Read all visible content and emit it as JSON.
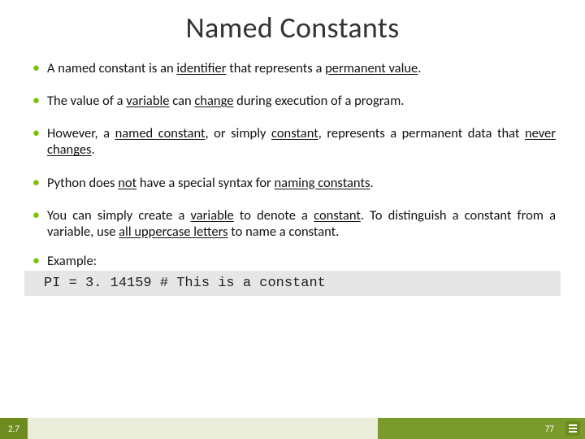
{
  "title": "Named Constants",
  "bullets": [
    {
      "segments": [
        {
          "t": "A named constant is an "
        },
        {
          "t": "identifier",
          "u": true
        },
        {
          "t": " that represents a "
        },
        {
          "t": "permanent value",
          "u": true
        },
        {
          "t": "."
        }
      ]
    },
    {
      "segments": [
        {
          "t": "The value of a "
        },
        {
          "t": "variable",
          "u": true
        },
        {
          "t": " can "
        },
        {
          "t": "change",
          "u": true
        },
        {
          "t": " during execution of a program."
        }
      ]
    },
    {
      "segments": [
        {
          "t": "However, a "
        },
        {
          "t": "named constant",
          "u": true
        },
        {
          "t": ", or simply "
        },
        {
          "t": "constant",
          "u": true
        },
        {
          "t": ", represents a permanent data that "
        },
        {
          "t": "never changes",
          "u": true
        },
        {
          "t": "."
        }
      ]
    },
    {
      "segments": [
        {
          "t": "Python does "
        },
        {
          "t": "not",
          "u": true
        },
        {
          "t": " have a special syntax for "
        },
        {
          "t": "naming constants",
          "u": true
        },
        {
          "t": "."
        }
      ]
    },
    {
      "segments": [
        {
          "t": "You can simply create a "
        },
        {
          "t": "variable",
          "u": true
        },
        {
          "t": " to denote a "
        },
        {
          "t": "constant",
          "u": true
        },
        {
          "t": ". To distinguish a constant from a variable, use "
        },
        {
          "t": "all uppercase letters",
          "u": true
        },
        {
          "t": " to name a constant."
        }
      ]
    }
  ],
  "example": {
    "label": "Example:",
    "code": "PI = 3. 14159 # This is a constant"
  },
  "footer": {
    "section": "2.7",
    "page": "77"
  }
}
